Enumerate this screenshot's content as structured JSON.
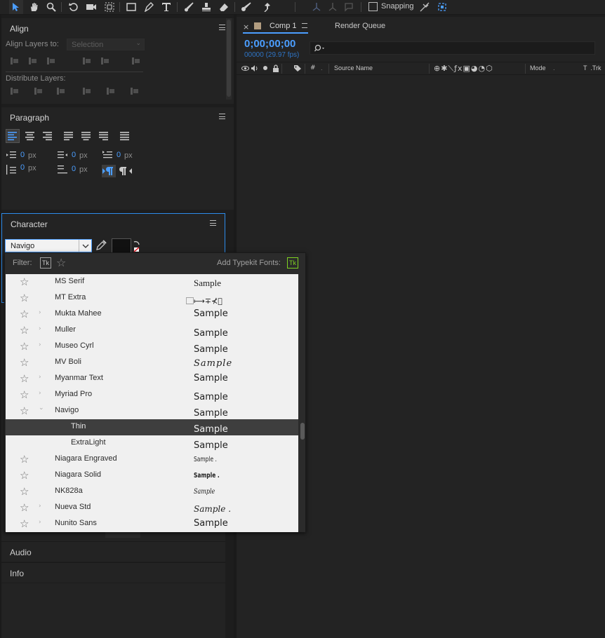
{
  "toolbar": {
    "snapping_label": "Snapping"
  },
  "align_panel": {
    "title": "Align",
    "align_layers_label": "Align Layers to:",
    "align_target": "Selection",
    "distribute_label": "Distribute Layers:"
  },
  "paragraph_panel": {
    "title": "Paragraph",
    "indent_left": "0",
    "indent_right": "0",
    "indent_first": "0",
    "space_before": "0",
    "space_after": "0",
    "unit": "px"
  },
  "character_panel": {
    "title": "Character",
    "font_family": "Navigo"
  },
  "font_dropdown": {
    "filter_label": "Filter:",
    "typekit_badge": "Tk",
    "add_typekit_label": "Add Typekit Fonts:",
    "sample_text": "Sample",
    "fonts": [
      {
        "name": "MS Serif",
        "sample": "Sample"
      },
      {
        "name": "MT Extra",
        "sample": "⃞⟼∓⊀⃞"
      },
      {
        "name": "Mukta Mahee",
        "sample": "Sample"
      },
      {
        "name": "Muller",
        "sample": "Sample"
      },
      {
        "name": "Museo Cyrl",
        "sample": "Sample"
      },
      {
        "name": "MV Boli",
        "sample": "Sample"
      },
      {
        "name": "Myanmar Text",
        "sample": "Sample"
      },
      {
        "name": "Myriad Pro",
        "sample": "Sample"
      },
      {
        "name": "Navigo",
        "sample": "Sample"
      },
      {
        "name": "Thin",
        "sample": "Sample"
      },
      {
        "name": "ExtraLight",
        "sample": "Sample"
      },
      {
        "name": "Niagara Engraved",
        "sample": "Sample ."
      },
      {
        "name": "Niagara Solid",
        "sample": "Sample ."
      },
      {
        "name": "NK828a",
        "sample": "Sample"
      },
      {
        "name": "Nueva Std",
        "sample": "Sample ."
      },
      {
        "name": "Nunito Sans",
        "sample": "Sample"
      }
    ]
  },
  "audio_panel": {
    "title": "Audio"
  },
  "info_panel": {
    "title": "Info"
  },
  "comp_panel": {
    "tab_label": "Comp 1",
    "render_queue_label": "Render Queue",
    "timecode": "0;00;00;00",
    "frame_info": "00000 (29.97 fps)",
    "columns": {
      "hash": "#",
      "source_name": "Source Name",
      "mode": "Mode",
      "trkmat": "T  .Trk"
    }
  },
  "colors": {
    "accent": "#4b9eff",
    "panel_bg": "#232323",
    "app_bg": "#1d1d1d",
    "list_bg": "#f0f0f0",
    "typekit_green": "#7ed321"
  }
}
